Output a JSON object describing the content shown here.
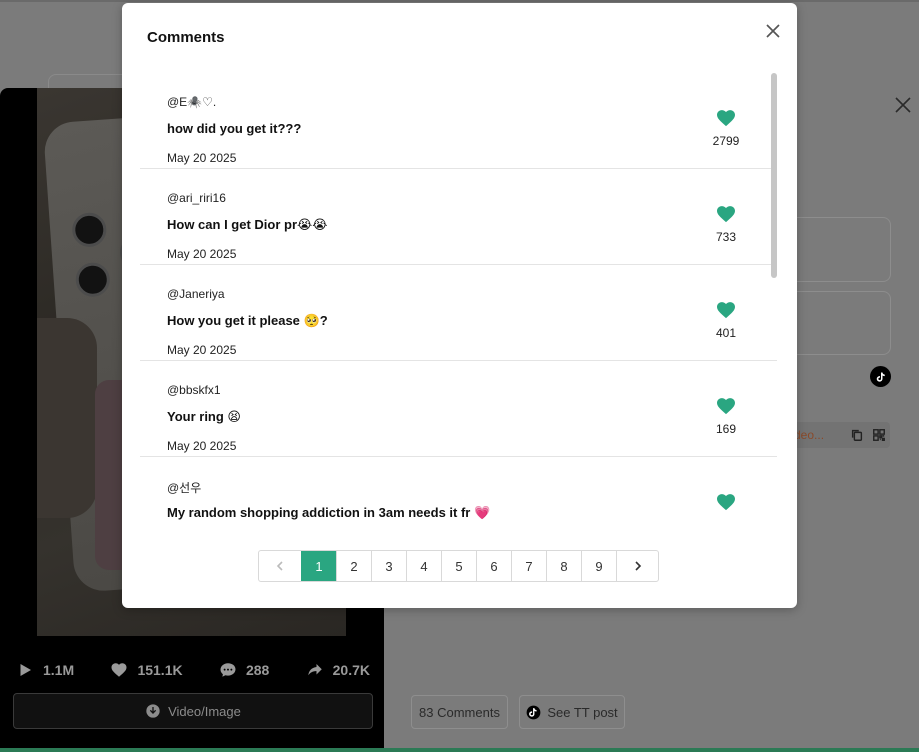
{
  "modal": {
    "title": "Comments",
    "comments": [
      {
        "user": "@E🕷️♡.",
        "text": "how did you get it???",
        "date": "May 20 2025",
        "likes": "2799"
      },
      {
        "user": "@ari_riri16",
        "text": "How can I get Dior pr😭😭",
        "date": "May 20 2025",
        "likes": "733"
      },
      {
        "user": "@Janeriya",
        "text": "How you get it please 🥺?",
        "date": "May 20 2025",
        "likes": "401"
      },
      {
        "user": "@bbskfx1",
        "text": "Your ring 😫",
        "date": "May 20 2025",
        "likes": "169"
      },
      {
        "user": "@선우",
        "text": "My random shopping addiction in 3am needs it fr 💗",
        "date": "",
        "likes": ""
      }
    ],
    "pagination": {
      "pages": [
        "1",
        "2",
        "3",
        "4",
        "5",
        "6",
        "7",
        "8",
        "9"
      ],
      "current": "1"
    }
  },
  "player": {
    "plays": "1.1M",
    "likes": "151.1K",
    "comments": "288",
    "shares": "20.7K",
    "download_label": "Video/Image"
  },
  "background": {
    "comments_button": "83 Comments",
    "tt_button": "See TT post",
    "link_text": "deo..."
  },
  "colors": {
    "accent": "#2aa681"
  }
}
